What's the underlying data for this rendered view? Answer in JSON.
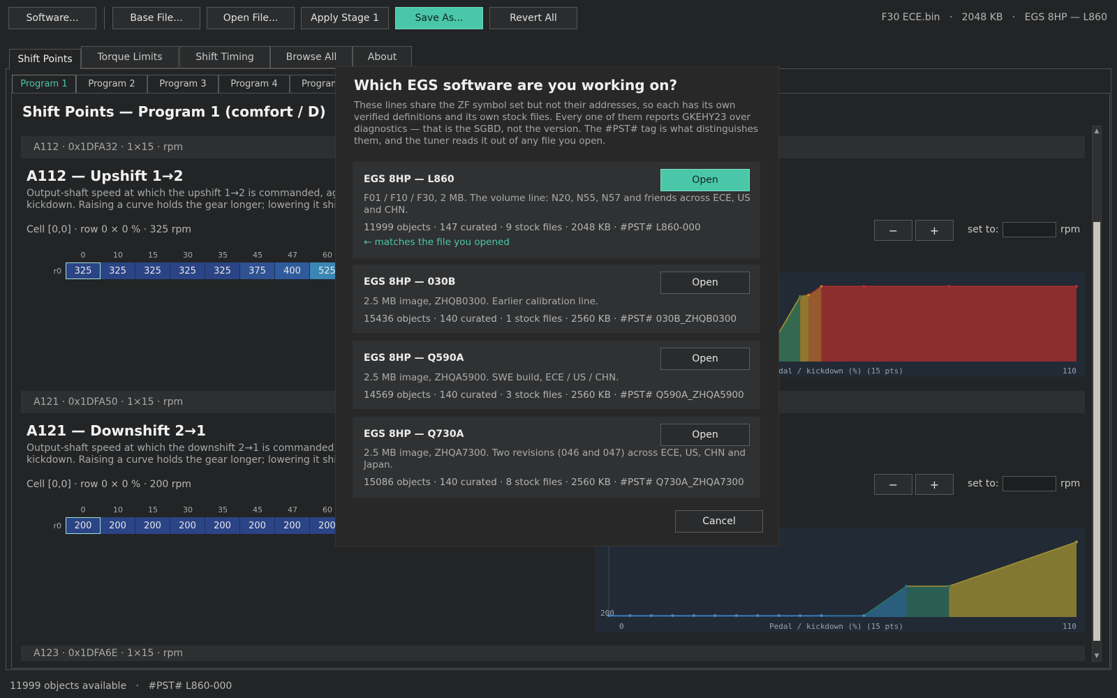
{
  "toolbar": {
    "software": "Software...",
    "base_file": "Base File...",
    "open_file": "Open File...",
    "apply_stage": "Apply Stage 1",
    "save_as": "Save As...",
    "revert_all": "Revert All",
    "file_info": "F30 ECE.bin   ·   2048 KB   ·   EGS 8HP — L860"
  },
  "tabs": [
    "Shift Points",
    "Torque Limits",
    "Shift Timing",
    "Browse All",
    "About"
  ],
  "program_tabs": [
    "Program 1",
    "Program 2",
    "Program 3",
    "Program 4",
    "Program"
  ],
  "section_title": "Shift Points — Program 1 (comfort / D)",
  "maps": [
    {
      "meta": "A112   ·   0x1DFA32   ·   1×15   ·   rpm",
      "name": "A112 — Upshift 1→2",
      "desc1": "Output-shaft speed at which the upshift 1→2 is commanded, against pedal / kickdown.",
      "desc2": "kickdown. Raising a curve holds the gear longer; lowering it shifts earlier.",
      "cell_info": "Cell [0,0]  ·  row 0 × 0 %  ·  325 rpm",
      "cols": [
        "0",
        "10",
        "15",
        "30",
        "35",
        "45",
        "47",
        "60"
      ],
      "row_label": "r0",
      "cells": [
        "325",
        "325",
        "325",
        "325",
        "325",
        "375",
        "400",
        "525"
      ],
      "minus": "−",
      "plus": "+",
      "set_to": "set to:",
      "unit": "rpm",
      "chart_axis": "Pedal / kickdown (%)  (15 pts)",
      "chart_x_min": "",
      "chart_x_max": "110",
      "chart_y_min": ""
    },
    {
      "meta": "A121   ·   0x1DFA50   ·   1×15   ·   rpm",
      "name": "A121 — Downshift 2→1",
      "desc1": "Output-shaft speed at which the downshift 2→1 is commanded, against pedal / kickdown.",
      "desc2": "kickdown. Raising a curve holds the gear longer; lowering it shifts earlier.",
      "cell_info": "Cell [0,0]  ·  row 0 × 0 %  ·  200 rpm",
      "cols": [
        "0",
        "10",
        "15",
        "30",
        "35",
        "45",
        "47",
        "60"
      ],
      "row_label": "r0",
      "cells": [
        "200",
        "200",
        "200",
        "200",
        "200",
        "200",
        "200",
        "200"
      ],
      "minus": "−",
      "plus": "+",
      "set_to": "set to:",
      "unit": "rpm",
      "chart_axis": "Pedal / kickdown (%)  (15 pts)",
      "chart_x_min": "0",
      "chart_x_max": "110",
      "chart_y_min": "200"
    },
    {
      "meta": "A123   ·   0x1DFA6E   ·   1×15   ·   rpm"
    }
  ],
  "status": "11999 objects available   ·   #PST# L860-000",
  "modal": {
    "title": "Which EGS software are you working on?",
    "intro": "These lines share the ZF symbol set but not their addresses, so each has its own verified definitions and its own stock files. Every one of them reports GKEHY23 over diagnostics — that is the SGBD, not the version. The #PST# tag is what distinguishes them, and the tuner reads it out of any file you open.",
    "cards": [
      {
        "title": "EGS 8HP — L860",
        "desc": "F01 / F10 / F30, 2 MB. The volume line: N20, N55, N57 and friends across ECE, US and CHN.",
        "meta": "11999 objects · 147 curated · 9 stock files · 2048 KB · #PST# L860-000",
        "match": "← matches the file you opened",
        "button": "Open"
      },
      {
        "title": "EGS 8HP — 030B",
        "desc": "2.5 MB image, ZHQB0300. Earlier calibration line.",
        "meta": "15436 objects · 140 curated · 1 stock files · 2560 KB · #PST# 030B_ZHQB0300",
        "button": "Open"
      },
      {
        "title": "EGS 8HP — Q590A",
        "desc": "2.5 MB image, ZHQA5900. SWE build, ECE / US / CHN.",
        "meta": "14569 objects · 140 curated · 3 stock files · 2560 KB · #PST# Q590A_ZHQA5900",
        "button": "Open"
      },
      {
        "title": "EGS 8HP — Q730A",
        "desc": "2.5 MB image, ZHQA7300. Two revisions (046 and 047) across ECE, US, CHN and Japan.",
        "meta": "15086 objects · 140 curated · 8 stock files · 2560 KB · #PST# Q730A_ZHQA7300",
        "button": "Open"
      }
    ],
    "cancel": "Cancel"
  },
  "chart_data": [
    {
      "type": "area",
      "title": "A112 — Upshift 1→2",
      "xlabel": "Pedal / kickdown (%)  (15 pts)",
      "ylabel": "rpm",
      "x": [
        0,
        5,
        10,
        15,
        20,
        25,
        30,
        35,
        40,
        45,
        47,
        50,
        60,
        80,
        110
      ],
      "values": [
        325,
        325,
        325,
        325,
        325,
        325,
        325,
        375,
        400,
        525,
        530,
        560,
        560,
        560,
        560
      ],
      "xlim": [
        0,
        110
      ]
    },
    {
      "type": "area",
      "title": "A121 — Downshift 2→1",
      "xlabel": "Pedal / kickdown (%)  (15 pts)",
      "ylabel": "rpm",
      "x": [
        0,
        5,
        10,
        15,
        20,
        25,
        30,
        35,
        40,
        45,
        50,
        60,
        70,
        80,
        110
      ],
      "values": [
        200,
        200,
        200,
        200,
        200,
        200,
        200,
        200,
        200,
        200,
        200,
        200,
        300,
        300,
        450
      ],
      "xlim": [
        0,
        110
      ],
      "ylim_min_label": 200
    }
  ]
}
